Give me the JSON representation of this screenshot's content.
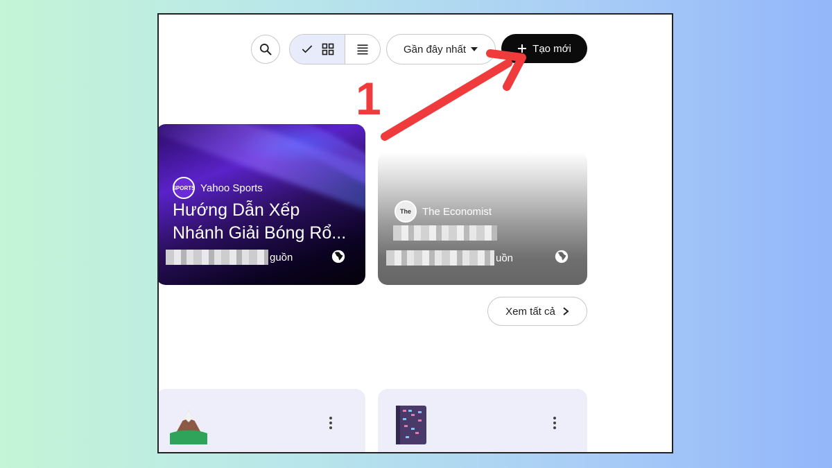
{
  "toolbar": {
    "search_icon": "search-icon",
    "sort_label": "Gần đây nhất",
    "create_label": "Tạo mới"
  },
  "annotation": {
    "step_number": "1",
    "color": "#ef3b3b"
  },
  "cards": [
    {
      "source": "Yahoo Sports",
      "logo_text": "SPORTS",
      "title_line1": "Hướng Dẫn Xếp",
      "title_line2": "Nhánh Giải Bóng Rổ...",
      "meta_suffix": "guồn"
    },
    {
      "source": "The Economist",
      "logo_text": "The",
      "title_line1": "",
      "title_line2": "",
      "meta_suffix": "uồn"
    }
  ],
  "see_all_label": "Xem tất cả",
  "colors": {
    "create_bg": "#0b0b0b",
    "view_selected_bg": "#e8ebfa",
    "notebook_card_bg": "#edeefa"
  }
}
